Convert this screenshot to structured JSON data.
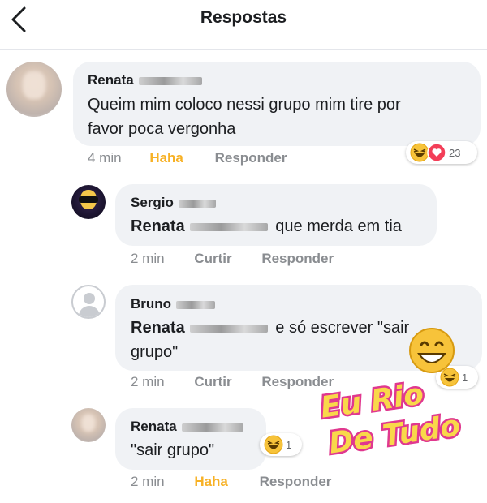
{
  "header": {
    "title": "Respostas",
    "back_icon": "back-chevron-icon"
  },
  "comments": [
    {
      "author": "Renata",
      "text_line1": "Queim mim coloco nessi grupo mim tire por",
      "text_line2": "favor poca vergonha",
      "time": "4 min",
      "action_primary": "Haha",
      "action_reply": "Responder",
      "reactions": [
        "haha-emoji-icon",
        "love-heart-icon"
      ],
      "reaction_count": "23"
    },
    {
      "author": "Sergio",
      "mention": "Renata",
      "text": "que merda em tia",
      "time": "2 min",
      "action_primary": "Curtir",
      "action_reply": "Responder"
    },
    {
      "author": "Bruno",
      "mention": "Renata",
      "text_line1": "e só escrever \"sair",
      "text_line2": "grupo\"",
      "time": "2 min",
      "action_primary": "Curtir",
      "action_reply": "Responder",
      "reactions": [
        "haha-emoji-icon"
      ],
      "reaction_count": "1"
    },
    {
      "author": "Renata",
      "text": "\"sair grupo\"",
      "time": "2 min",
      "action_primary": "Haha",
      "action_reply": "Responder",
      "reactions": [
        "haha-emoji-icon"
      ],
      "reaction_count": "1"
    }
  ],
  "watermark": {
    "line1": "Eu Rio",
    "line2": "De Tudo"
  },
  "colors": {
    "bubble": "#f0f2f5",
    "meta": "#8a8d91",
    "haha": "#f7b125",
    "watermark_fill": "#f9d84a",
    "watermark_stroke": "#e0388f"
  }
}
